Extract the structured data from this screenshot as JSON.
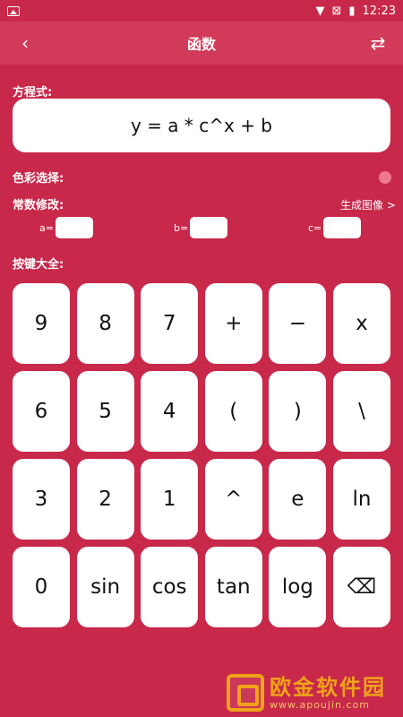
{
  "status_bar": {
    "time": "12:23"
  },
  "app_bar": {
    "title": "函数",
    "back_icon": "‹",
    "swap_icon": "⇄"
  },
  "formula": {
    "label": "方程式:",
    "expression": "y = a * c^x + b"
  },
  "color_select": {
    "label": "色彩选择:",
    "dot_color": "#f07a8d"
  },
  "constants": {
    "label": "常数修改:",
    "generate_link": "生成图像 >",
    "a_label": "a=",
    "b_label": "b=",
    "c_label": "c="
  },
  "keys_label": "按键大全:",
  "keys": [
    "9",
    "8",
    "7",
    "+",
    "−",
    "x",
    "6",
    "5",
    "4",
    "(",
    ")",
    "\\",
    "3",
    "2",
    "1",
    "^",
    "e",
    "ln",
    "0",
    "sin",
    "cos",
    "tan",
    "log",
    "⌫"
  ],
  "watermark": {
    "title": "欧金软件园",
    "url": "www.apoujin.com"
  }
}
